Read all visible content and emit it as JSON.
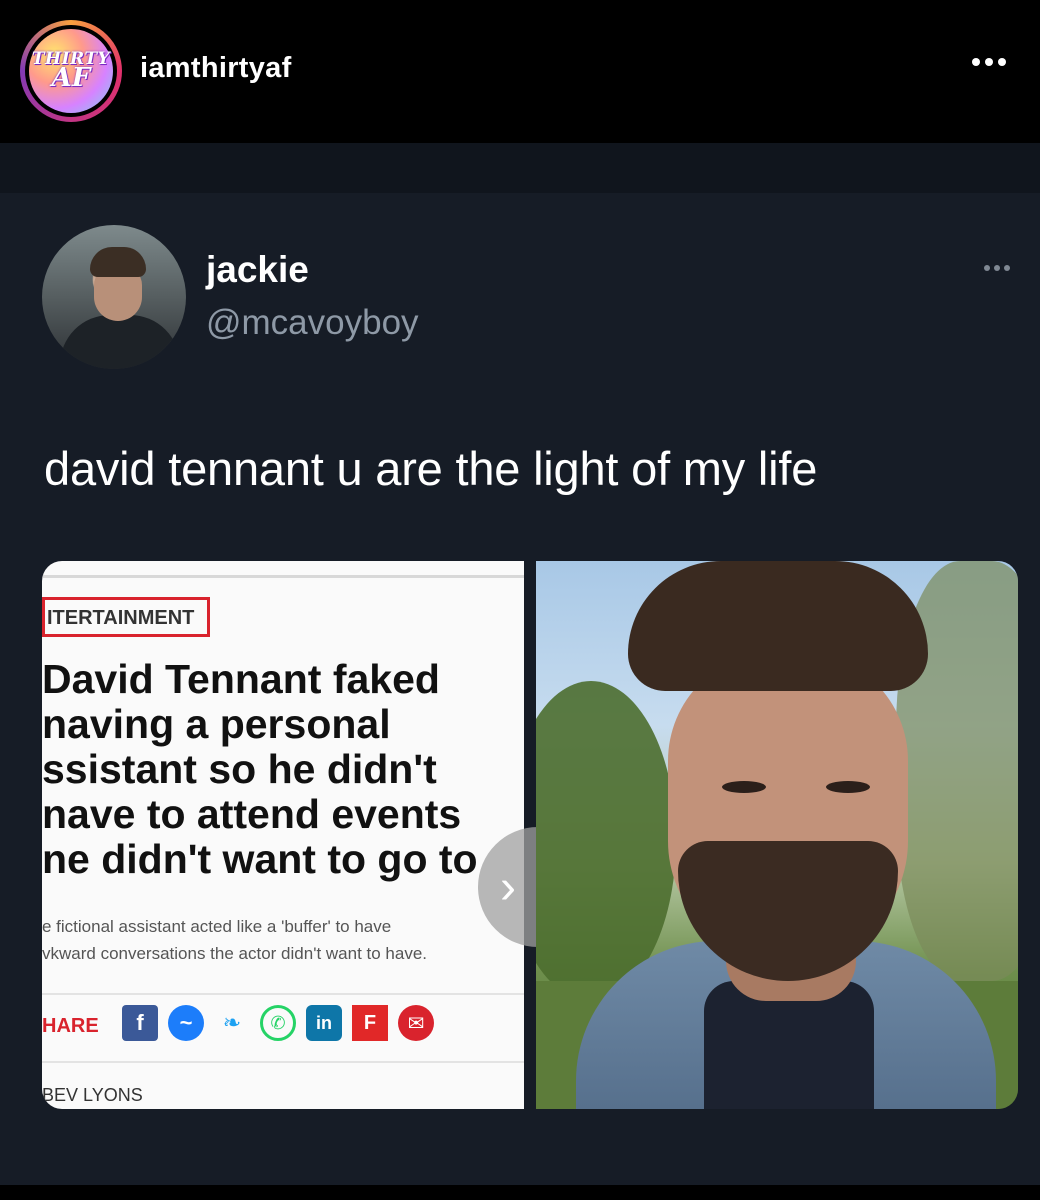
{
  "app": {
    "account": {
      "username": "iamthirtyaf",
      "logo_line1": "THIRTY",
      "logo_line2": "AF"
    }
  },
  "tweet": {
    "display_name": "jackie",
    "handle": "@mcavoyboy",
    "text": "david tennant u are the light of my life"
  },
  "article": {
    "section": "ITERTAINMENT",
    "headline_lines": [
      "David Tennant faked",
      "naving a personal",
      "ssistant so he didn't",
      "nave to attend events",
      "ne didn't want to go to"
    ],
    "sub_lines": [
      "e fictional assistant acted like a 'buffer' to have",
      "vkward conversations the actor didn't want to have."
    ],
    "share_label": "HARE",
    "share_icons": [
      "facebook-icon",
      "messenger-icon",
      "twitter-icon",
      "whatsapp-icon",
      "linkedin-icon",
      "flipboard-icon",
      "email-icon"
    ],
    "share_glyphs": [
      "f",
      "~",
      "❧",
      "✆",
      "in",
      "F",
      "✉"
    ],
    "byline": "BEV LYONS"
  },
  "colors": {
    "tweet_bg": "#161c26",
    "brand_red": "#d9232d",
    "handle_gray": "#8e99a6"
  }
}
